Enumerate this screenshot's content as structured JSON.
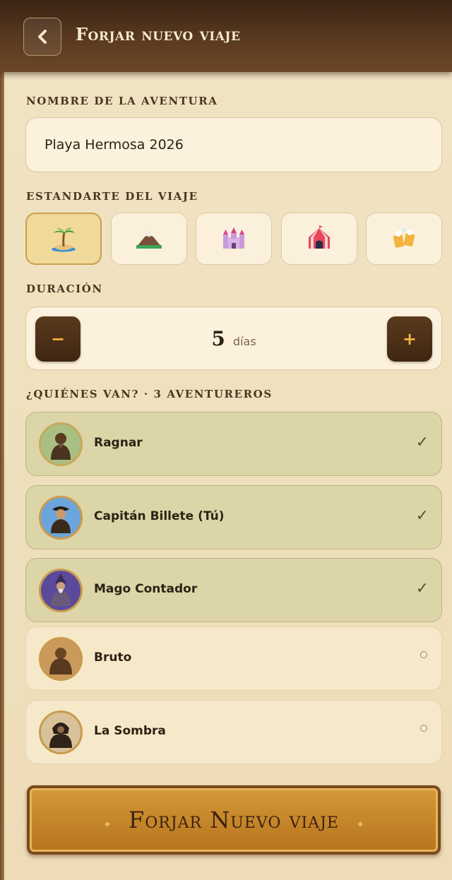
{
  "header": {
    "back_icon": "chevron-left-icon",
    "title": "Forjar nuevo viaje"
  },
  "adventure_name": {
    "label": "NOMBRE DE LA AVENTURA",
    "value": "Playa Hermosa 2026"
  },
  "banner": {
    "label": "ESTANDARTE DEL VIAJE",
    "options": [
      {
        "icon": "palm-island-icon",
        "selected": true
      },
      {
        "icon": "mountain-icon",
        "selected": false
      },
      {
        "icon": "castle-icon",
        "selected": false
      },
      {
        "icon": "circus-tent-icon",
        "selected": false
      },
      {
        "icon": "beer-mugs-icon",
        "selected": false
      }
    ]
  },
  "duration": {
    "label": "DURACIÓN",
    "value": "5",
    "unit": "días",
    "minus_label": "−",
    "plus_label": "+"
  },
  "members": {
    "label": "¿QUIÉNES VAN? · 3 AVENTUREROS",
    "list": [
      {
        "name": "Ragnar",
        "selected": true,
        "mark": "✓"
      },
      {
        "name": "Capitán Billete (Tú)",
        "selected": true,
        "mark": "✓"
      },
      {
        "name": "Mago Contador",
        "selected": true,
        "mark": "✓"
      },
      {
        "name": "Bruto",
        "selected": false,
        "mark": ""
      },
      {
        "name": "La Sombra",
        "selected": false,
        "mark": ""
      }
    ]
  },
  "submit": {
    "label": "Forjar Nuevo viaje"
  },
  "colors": {
    "header": "#4a2e18",
    "accent": "#c98a2c",
    "selected_member": "#dcd5a8"
  }
}
